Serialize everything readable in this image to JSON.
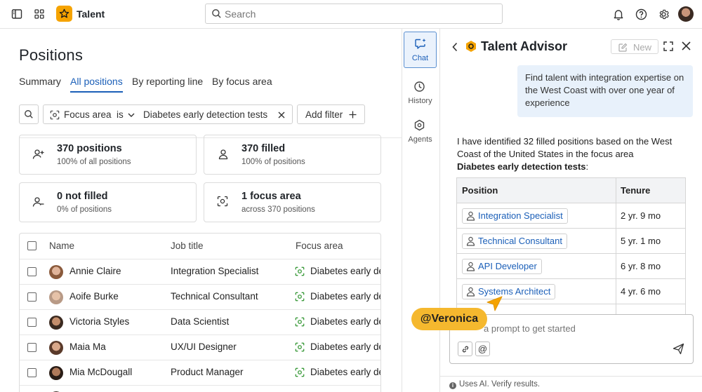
{
  "topbar": {
    "app_name": "Talent",
    "search_placeholder": "Search"
  },
  "main": {
    "title": "Positions",
    "tabs": [
      {
        "label": "Summary"
      },
      {
        "label": "All positions",
        "active": true
      },
      {
        "label": "By reporting line"
      },
      {
        "label": "By focus area"
      }
    ],
    "filter": {
      "field": "Focus area",
      "operator": "is",
      "value": "Diabetes early detection tests",
      "add_label": "Add filter"
    },
    "cards": [
      {
        "title": "370 positions",
        "sub": "100% of all positions",
        "icon": "person-add-icon"
      },
      {
        "title": "370 filled",
        "sub": "100% of positions",
        "icon": "person-icon"
      },
      {
        "title": "0 not filled",
        "sub": "0% of positions",
        "icon": "person-remove-icon"
      },
      {
        "title": "1 focus area",
        "sub": "across 370 positions",
        "icon": "focus-icon"
      }
    ],
    "table": {
      "headers": {
        "name": "Name",
        "job": "Job title",
        "focus": "Focus area"
      },
      "rows": [
        {
          "name": "Annie Claire",
          "job": "Integration Specialist",
          "focus": "Diabetes early de"
        },
        {
          "name": "Aoife Burke",
          "job": "Technical Consultant",
          "focus": "Diabetes early de"
        },
        {
          "name": "Victoria Styles",
          "job": "Data Scientist",
          "focus": "Diabetes early de"
        },
        {
          "name": "Maia Ma",
          "job": "UX/UI Designer",
          "focus": "Diabetes early de"
        },
        {
          "name": "Mia McDougall",
          "job": "Product Manager",
          "focus": "Diabetes early de"
        }
      ]
    }
  },
  "rail": {
    "items": [
      {
        "label": "Chat",
        "active": true
      },
      {
        "label": "History"
      },
      {
        "label": "Agents"
      }
    ]
  },
  "advisor": {
    "title": "Talent Advisor",
    "new_label": "New",
    "user_message": "Find talent with integration expertise on the West Coast with over one year of experience",
    "ai_message": "I have identified 32 filled positions based on the West Coast of the United States in the focus area",
    "ai_message_bold": "Diabetes early detection tests",
    "ai_message_end": ":",
    "table_headers": {
      "position": "Position",
      "tenure": "Tenure"
    },
    "results": [
      {
        "position": "Integration Specialist",
        "tenure": "2 yr. 9 mo"
      },
      {
        "position": "Technical Consultant",
        "tenure": "5 yr. 1 mo"
      },
      {
        "position": "API Developer",
        "tenure": "6 yr. 8 mo"
      },
      {
        "position": "Systems Architect",
        "tenure": "4 yr. 6 mo"
      }
    ],
    "composer_placeholder": "a prompt to get started",
    "mention_button": "@",
    "disclaimer": "Uses AI. Verify results."
  },
  "mention_tag": "@Veronica",
  "colors": {
    "accent": "#1b5fb8",
    "brand": "#f5a300",
    "mention": "#f5b82e",
    "user_bubble": "#e8f1fb"
  }
}
